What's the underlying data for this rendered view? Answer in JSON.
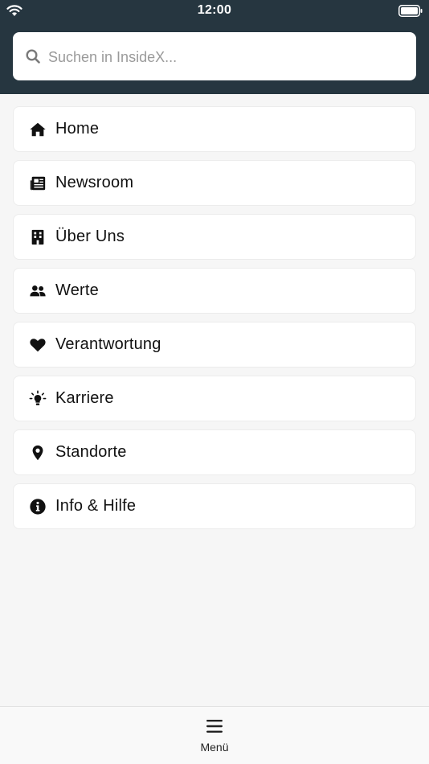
{
  "status_bar": {
    "time": "12:00"
  },
  "search": {
    "placeholder": "Suchen in InsideX..."
  },
  "menu": {
    "items": [
      {
        "label": "Home",
        "icon": "home-icon"
      },
      {
        "label": "Newsroom",
        "icon": "newspaper-icon"
      },
      {
        "label": "Über Uns",
        "icon": "building-icon"
      },
      {
        "label": "Werte",
        "icon": "users-icon"
      },
      {
        "label": "Verantwortung",
        "icon": "heart-icon"
      },
      {
        "label": "Karriere",
        "icon": "lightbulb-icon"
      },
      {
        "label": "Standorte",
        "icon": "map-pin-icon"
      },
      {
        "label": "Info & Hilfe",
        "icon": "info-icon"
      }
    ]
  },
  "tab_bar": {
    "menu_label": "Menü",
    "menu_icon": "hamburger-icon"
  },
  "colors": {
    "header": "#263640",
    "background": "#f6f6f6",
    "card": "#ffffff"
  }
}
